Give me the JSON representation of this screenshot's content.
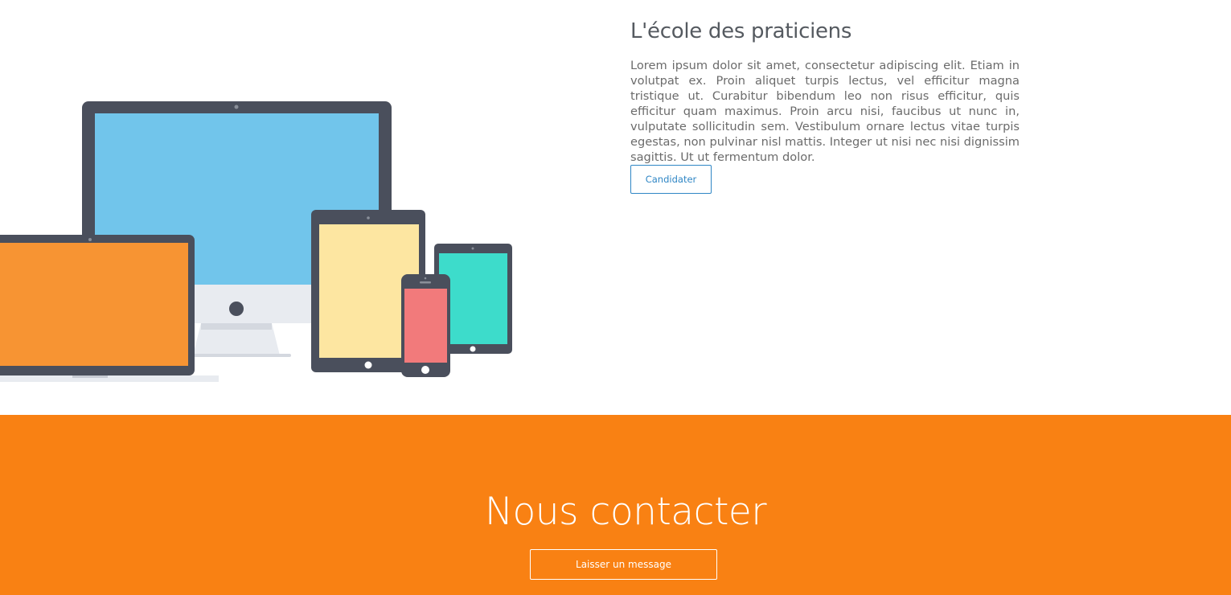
{
  "about": {
    "title": "L'école des praticiens",
    "body": "Lorem ipsum dolor sit amet, consectetur adipiscing elit. Etiam in volutpat ex. Proin aliquet turpis lectus, vel efficitur magna tristique ut. Curabitur bibendum leo non risus efficitur, quis efficitur quam maximus. Proin arcu nisi, faucibus ut nunc in, vulputate sollicitudin sem. Vestibulum ornare lectus vitae turpis egestas, non pulvinar nisl mattis. Integer ut nisi nec nisi dignissim sagittis. Ut ut fermentum dolor.",
    "button_label": "Candidater",
    "illustration_icon": "responsive-devices-illustration"
  },
  "contact": {
    "title": "Nous contacter",
    "button_label": "Laisser un message"
  },
  "colors": {
    "accent_orange": "#f98113",
    "link_blue": "#2f86c5",
    "device_frame": "#4a4f5c",
    "monitor_screen": "#71c5eb",
    "laptop_screen": "#f79433",
    "tablet_screen": "#fde6a1",
    "phone_screen": "#f27a7b",
    "small_tablet_screen": "#3ddccb"
  }
}
